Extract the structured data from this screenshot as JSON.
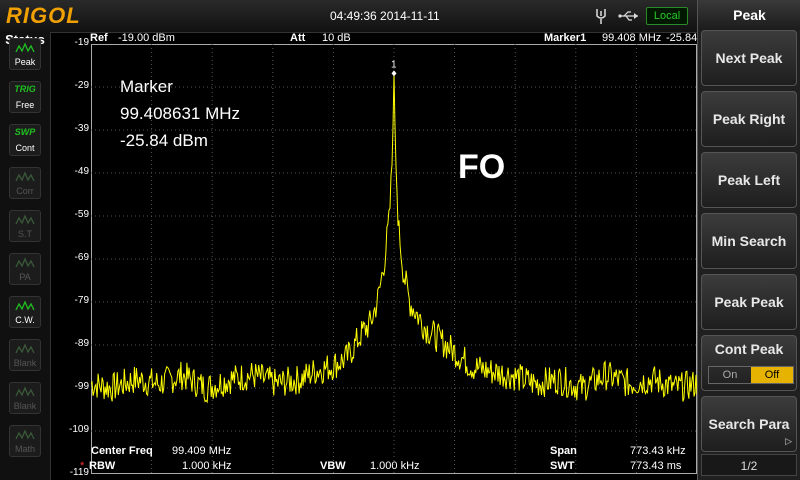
{
  "header": {
    "brand": "RIGOL",
    "datetime": "04:49:36 2014-11-11",
    "remote_status": "Local",
    "icons": [
      "probe-icon",
      "usb-icon"
    ]
  },
  "status": {
    "title": "Status",
    "items": [
      {
        "top": "",
        "label": "Peak",
        "icon": "peak-wave-icon",
        "active": true
      },
      {
        "top": "TRIG",
        "label": "Free",
        "icon": "",
        "active": true
      },
      {
        "top": "SWP",
        "label": "Cont",
        "icon": "",
        "active": true
      },
      {
        "top": "",
        "label": "Corr",
        "icon": "corr-icon",
        "active": false
      },
      {
        "top": "",
        "label": "S.T",
        "icon": "st-icon",
        "active": false
      },
      {
        "top": "",
        "label": "PA",
        "icon": "pa-icon",
        "active": false
      },
      {
        "top": "",
        "label": "C.W.",
        "icon": "cw-icon",
        "active": true
      },
      {
        "top": "",
        "label": "Blank",
        "icon": "blank-icon",
        "active": false
      },
      {
        "top": "",
        "label": "Blank",
        "icon": "blank-icon",
        "active": false
      },
      {
        "top": "",
        "label": "Math",
        "icon": "math-icon",
        "active": false
      }
    ]
  },
  "measure_bar": {
    "ref_label": "Ref",
    "ref_value": "-19.00 dBm",
    "att_label": "Att",
    "att_value": "10 dB",
    "marker_label": "Marker1",
    "marker_freq": "99.408 MHz",
    "marker_level": "-25.84 dBm"
  },
  "marker_readout": {
    "title": "Marker",
    "freq": "99.408631 MHz",
    "level": "-25.84 dBm",
    "trace_marker_number": "1"
  },
  "overlay_text": "FO",
  "footer": {
    "center_freq_label": "Center Freq",
    "center_freq_value": "99.409 MHz",
    "span_label": "Span",
    "span_value": "773.43 kHz",
    "rbw_flag": "*",
    "rbw_label": "RBW",
    "rbw_value": "1.000 kHz",
    "vbw_label": "VBW",
    "vbw_value": "1.000 kHz",
    "swt_label": "SWT",
    "swt_value": "773.43 ms"
  },
  "softkeys": {
    "title": "Peak",
    "buttons": [
      "Next Peak",
      "Peak Right",
      "Peak Left",
      "Min Search",
      "Peak Peak"
    ],
    "cont_peak": {
      "label": "Cont Peak",
      "on": "On",
      "off": "Off",
      "selected": "Off"
    },
    "search_para": "Search Para",
    "page": "1/2"
  },
  "chart_data": {
    "type": "line",
    "ylabel": "",
    "y_ticks": [
      "-19",
      "-29",
      "-39",
      "-49",
      "-59",
      "-69",
      "-79",
      "-89",
      "-99",
      "-109",
      "-119"
    ],
    "ylim": [
      -119,
      -19
    ],
    "x_center_mhz": 99.409,
    "span_khz": 773.43,
    "trace_color": "#ffff00",
    "grid": true,
    "series": [
      {
        "x_offset_khz": [
          -386.7,
          -360,
          -330,
          -300,
          -270,
          -240,
          -210,
          -180,
          -150,
          -120,
          -100,
          -80,
          -60,
          -40,
          -30,
          -20,
          -12,
          -6,
          -2,
          0,
          2,
          6,
          12,
          20,
          30,
          40,
          60,
          80,
          100,
          120,
          150,
          180,
          210,
          240,
          270,
          300,
          330,
          360,
          386.7
        ],
        "level_dbm": [
          -98,
          -99,
          -97,
          -98,
          -96,
          -99,
          -97,
          -96,
          -98,
          -97,
          -95,
          -94,
          -92,
          -86,
          -84,
          -78,
          -69,
          -60,
          -45,
          -25.84,
          -45,
          -62,
          -72,
          -79,
          -82,
          -85,
          -88,
          -91,
          -94,
          -95,
          -96,
          -98,
          -97,
          -99,
          -96,
          -98,
          -97,
          -99,
          -98
        ]
      }
    ]
  }
}
